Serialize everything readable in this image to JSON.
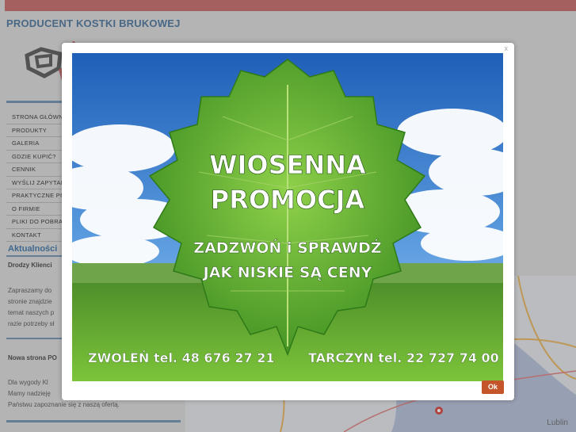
{
  "header": {
    "title": "PRODUCENT KOSTKI BRUKOWEJ"
  },
  "nav": {
    "items": [
      {
        "label": "STRONA GŁÓWNA"
      },
      {
        "label": "PRODUKTY"
      },
      {
        "label": "GALERIA"
      },
      {
        "label": "GDZIE KUPIĆ?"
      },
      {
        "label": "CENNIK"
      },
      {
        "label": "WYŚLIJ ZAPYTANIE"
      },
      {
        "label": "PRAKTYCZNE PORADY"
      },
      {
        "label": "O FIRMIE"
      },
      {
        "label": "PLIKI DO POBRANIA"
      },
      {
        "label": "KONTAKT"
      }
    ]
  },
  "news": {
    "heading": "Aktualności",
    "items": [
      {
        "title": "Drodzy Klienci",
        "lines": [
          "Zapraszamy do",
          "stronie znajdzie",
          "temat naszych p",
          "razie potrzeby sł"
        ]
      },
      {
        "title": "Nowa strona PO",
        "lines": [
          "Dla wygody Kl",
          "Mamy nadzieję",
          "Państwu zapoznanie się z naszą ofertą."
        ]
      }
    ]
  },
  "map": {
    "label": "Lublin"
  },
  "modal": {
    "close_label": "x",
    "ok_label": "Ok",
    "promo": {
      "headline_1": "WIOSENNA",
      "headline_2": "PROMOCJA",
      "sub_1": "ZADZWOŃ i SPRAWDŹ",
      "sub_2": "JAK NISKIE SĄ CENY",
      "contact_left": "ZWOLEŃ  tel. 48 676 27 21",
      "contact_right": "TARCZYN tel. 22 727 74 00"
    }
  },
  "colors": {
    "topbar": "#c97474",
    "title": "#5a7fa3",
    "accent": "#4e7fae",
    "ok_button": "#c4552b",
    "sky": "#2f6fc4",
    "grass": "#5aa62a",
    "leaf": "#5fae2e"
  }
}
